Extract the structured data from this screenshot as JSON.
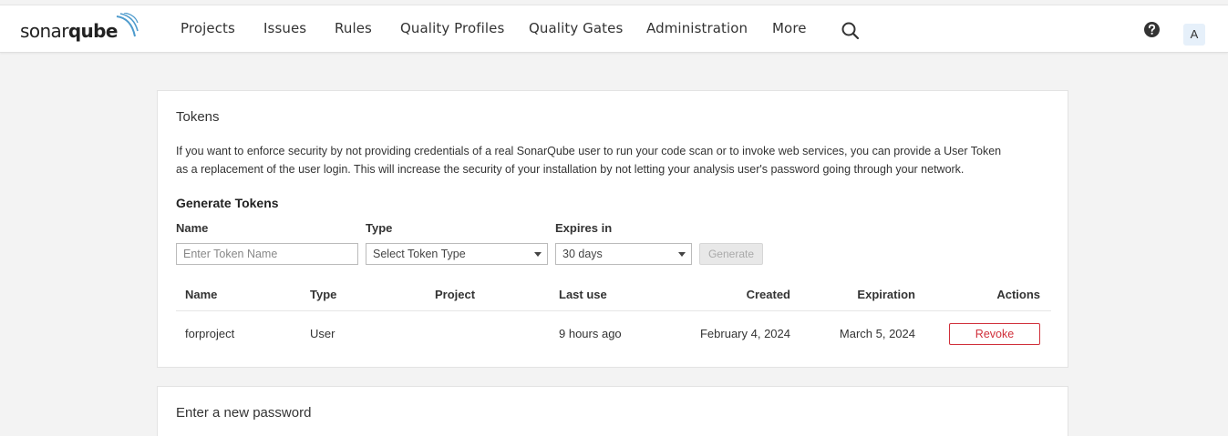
{
  "brand": {
    "light": "sonar",
    "bold": "qube"
  },
  "nav": {
    "items": [
      "Projects",
      "Issues",
      "Rules",
      "Quality Profiles",
      "Quality Gates",
      "Administration",
      "More"
    ],
    "avatar_initial": "A"
  },
  "icons": {
    "search": "search-icon",
    "help": "help-icon"
  },
  "tokens_card": {
    "title": "Tokens",
    "description_line1": "If you want to enforce security by not providing credentials of a real SonarQube user to run your code scan or to invoke web services, you can provide a User Token",
    "description_line2": "as a replacement of the user login. This will increase the security of your installation by not letting your analysis user's password going through your network.",
    "generate_title": "Generate Tokens",
    "name_label": "Name",
    "name_placeholder": "Enter Token Name",
    "type_label": "Type",
    "type_selected": "Select Token Type",
    "expires_label": "Expires in",
    "expires_selected": "30 days",
    "generate_button": "Generate",
    "table": {
      "headers": [
        "Name",
        "Type",
        "Project",
        "Last use",
        "Created",
        "Expiration",
        "Actions"
      ],
      "rows": [
        {
          "name": "forproject",
          "type": "User",
          "project": "",
          "last_use": "9 hours ago",
          "created": "February 4, 2024",
          "expiration": "March 5, 2024",
          "action": "Revoke"
        }
      ]
    }
  },
  "password_card": {
    "title": "Enter a new password"
  },
  "colors": {
    "accent": "#236a97",
    "danger": "#d02f3a",
    "background": "#f3f3f3"
  }
}
